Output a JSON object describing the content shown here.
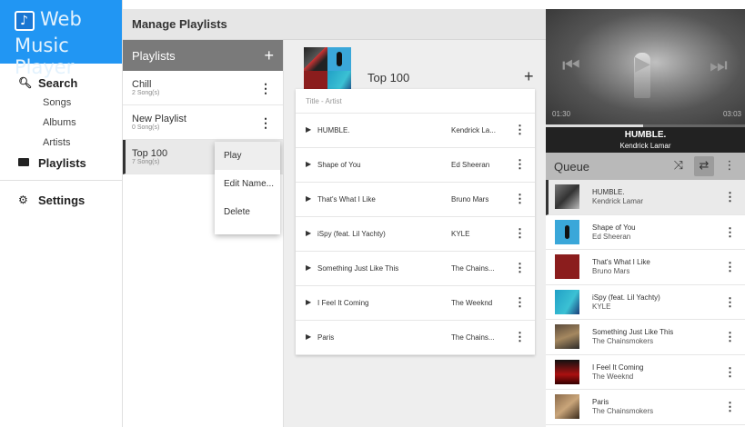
{
  "app": {
    "logo_line1": "Web",
    "logo_line2": "Music Player"
  },
  "sidebar": {
    "search_label": "Search",
    "sub_items": [
      "Songs",
      "Albums",
      "Artists"
    ],
    "playlists_label": "Playlists",
    "settings_label": "Settings"
  },
  "header": {
    "title": "Manage Playlists"
  },
  "playlists_panel": {
    "title": "Playlists",
    "add_icon": "plus-icon",
    "items": [
      {
        "name": "Chill",
        "count": "2 Song(s)"
      },
      {
        "name": "New Playlist",
        "count": "0 Song(s)"
      },
      {
        "name": "Top 100",
        "count": "7 Song(s)"
      }
    ],
    "active_index": 2
  },
  "context_menu": {
    "items": [
      "Play",
      "Edit Name...",
      "Delete"
    ]
  },
  "playlist_detail": {
    "title": "Top 100",
    "column_header": "Title - Artist",
    "songs": [
      {
        "title": "HUMBLE.",
        "artist": "Kendrick La..."
      },
      {
        "title": "Shape of You",
        "artist": "Ed Sheeran"
      },
      {
        "title": "That's What I Like",
        "artist": "Bruno Mars"
      },
      {
        "title": "iSpy (feat. Lil Yachty)",
        "artist": "KYLE"
      },
      {
        "title": "Something Just Like This",
        "artist": "The Chains..."
      },
      {
        "title": "I Feel It Coming",
        "artist": "The Weeknd"
      },
      {
        "title": "Paris",
        "artist": "The Chains..."
      }
    ]
  },
  "player": {
    "current_time": "01:30",
    "total_time": "03:03",
    "progress_fraction": 0.49,
    "now_title": "HUMBLE.",
    "now_artist": "Kendrick Lamar"
  },
  "queue": {
    "title": "Queue",
    "icons": [
      "shuffle-icon",
      "repeat-icon",
      "more-icon"
    ],
    "items": [
      {
        "title": "HUMBLE.",
        "artist": "Kendrick Lamar"
      },
      {
        "title": "Shape of You",
        "artist": "Ed Sheeran"
      },
      {
        "title": "That's What I Like",
        "artist": "Bruno Mars"
      },
      {
        "title": "iSpy (feat. Lil Yachty)",
        "artist": "KYLE"
      },
      {
        "title": "Something Just Like This",
        "artist": "The Chainsmokers"
      },
      {
        "title": "I Feel It Coming",
        "artist": "The Weeknd"
      },
      {
        "title": "Paris",
        "artist": "The Chainsmokers"
      }
    ]
  }
}
